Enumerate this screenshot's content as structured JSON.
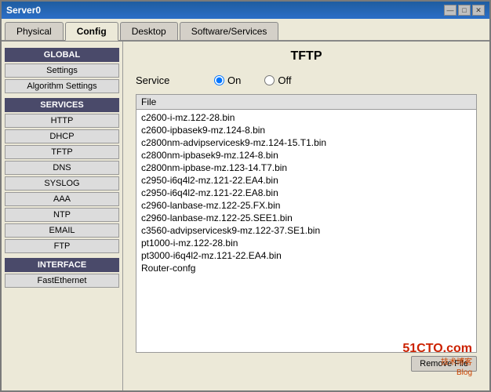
{
  "window": {
    "title": "Server0",
    "controls": {
      "minimize": "—",
      "maximize": "□",
      "close": "✕"
    }
  },
  "tabs": [
    {
      "id": "physical",
      "label": "Physical",
      "active": false
    },
    {
      "id": "config",
      "label": "Config",
      "active": true
    },
    {
      "id": "desktop",
      "label": "Desktop",
      "active": false
    },
    {
      "id": "software-services",
      "label": "Software/Services",
      "active": false
    }
  ],
  "sidebar": {
    "sections": [
      {
        "header": "GLOBAL",
        "items": [
          "Settings",
          "Algorithm Settings"
        ]
      },
      {
        "header": "SERVICES",
        "items": [
          "HTTP",
          "DHCP",
          "TFTP",
          "DNS",
          "SYSLOG",
          "AAA",
          "NTP",
          "EMAIL",
          "FTP"
        ]
      },
      {
        "header": "INTERFACE",
        "items": [
          "FastEthernet"
        ]
      }
    ]
  },
  "main": {
    "title": "TFTP",
    "service": {
      "label": "Service",
      "options": [
        {
          "id": "on",
          "label": "On",
          "selected": true
        },
        {
          "id": "off",
          "label": "Off",
          "selected": false
        }
      ]
    },
    "file_list": {
      "header": "File",
      "files": [
        "c2600-i-mz.122-28.bin",
        "c2600-ipbasek9-mz.124-8.bin",
        "c2800nm-advipservicesk9-mz.124-15.T1.bin",
        "c2800nm-ipbasek9-mz.124-8.bin",
        "c2800nm-ipbase-mz.123-14.T7.bin",
        "c2950-i6q4l2-mz.121-22.EA4.bin",
        "c2950-i6q4l2-mz.121-22.EA8.bin",
        "c2960-lanbase-mz.122-25.FX.bin",
        "c2960-lanbase-mz.122-25.SEE1.bin",
        "c3560-advipservicesk9-mz.122-37.SE1.bin",
        "pt1000-i-mz.122-28.bin",
        "pt3000-i6q4l2-mz.121-22.EA4.bin",
        "Router-confg"
      ]
    },
    "buttons": {
      "remove_file": "Remove File"
    }
  },
  "watermark": {
    "line1": "51CTO.com",
    "line2": "技术博客",
    "line3": "Blog"
  }
}
